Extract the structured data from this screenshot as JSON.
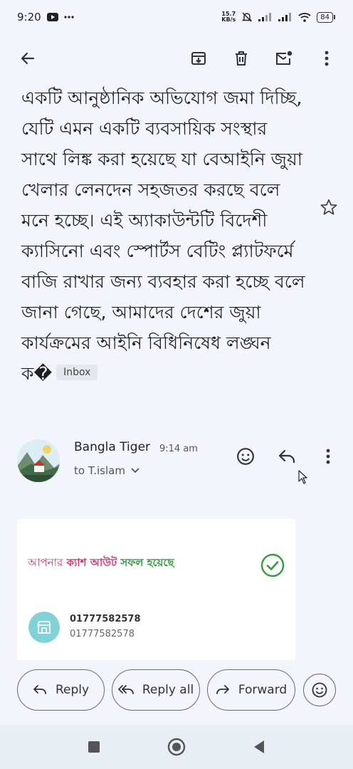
{
  "status_bar": {
    "time": "9:20",
    "net_speed_top": "15.7",
    "net_speed_bottom": "KB/s",
    "battery": "84"
  },
  "email": {
    "subject": "একটি আনুষ্ঠানিক অভিযোগ জমা দিচ্ছি, যেটি এমন একটি ব্যবসায়িক সংস্থার সাথে লিঙ্ক করা হয়েছে যা বেআইনি জুয়া খেলার লেনদেন সহজতর করছে বলে মনে হচ্ছে। এই অ্যাকাউন্টটি বিদেশী ক্যাসিনো এবং স্পোর্টস বেটিং প্ল্যাটফর্মে বাজি রাখার জন্য ব্যবহার করা হচ্ছে বলে জানা গেছে, আমাদের দেশের জুয়া কার্যক্রমের আইনি বিধিনিষেধ লঙ্ঘন ক�",
    "label_chip": "Inbox",
    "sender_name": "Bangla Tiger",
    "time": "9:14 am",
    "recipient": "to T.islam"
  },
  "card": {
    "title_part1": "আপনার",
    "title_part2": "ক্যাশ আউট",
    "title_part3": "সফল হয়েছে",
    "phone_primary": "01777582578",
    "phone_secondary": "01777582578"
  },
  "reply_bar": {
    "reply": "Reply",
    "reply_all": "Reply all",
    "forward": "Forward"
  },
  "colors": {
    "accent_pink": "#d8336f",
    "accent_green": "#2e9e3c",
    "merchant_teal": "#7fd3d6"
  }
}
